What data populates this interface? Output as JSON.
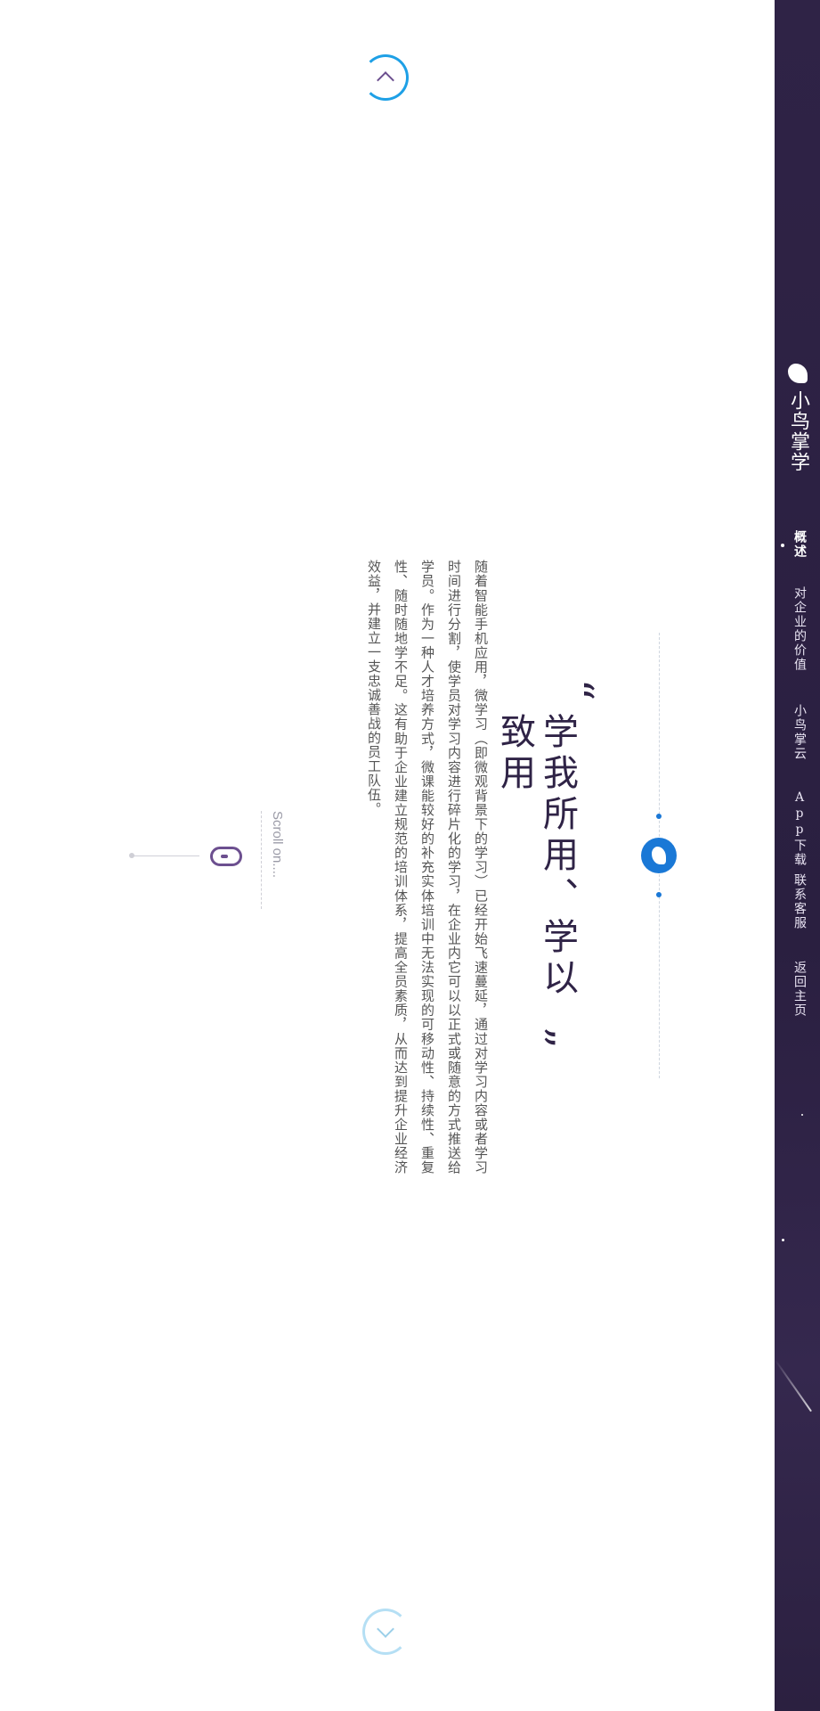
{
  "brand": {
    "name": "小鸟掌学",
    "logo_icon": "bird-logo-icon"
  },
  "nav": {
    "items": [
      {
        "label": "概述",
        "active": true
      },
      {
        "label": "对企业的价值",
        "active": false
      },
      {
        "label": "小鸟掌云",
        "active": false
      },
      {
        "label": "App下载",
        "active": false
      },
      {
        "label": "联系客服",
        "active": false
      },
      {
        "label": "返回主页",
        "active": false
      }
    ]
  },
  "hero": {
    "headline": "学我所用、学以致用",
    "quote_open": "“",
    "quote_close": "”",
    "body": "随着智能手机应用，微学习（即微观背景下的学习）已经开始飞速蔓延，通过对学习内容或者学习时间进行分割，使学员对学习内容进行碎片化的学习，在企业内它可以以正式或随意的方式推送给学员。作为一种人才培养方式，微课能较好的补充实体培训中无法实现的可移动性、持续性、重复性、随时随地学不足。这有助于企业建立规范的培训体系，提高全员素质，从而达到提升企业经济效益，并建立一支忠诚善战的员工队伍。"
  },
  "scroll_hint": {
    "text": "Scroll on....",
    "icon": "mouse-icon"
  },
  "controls": {
    "up_icon": "chevron-up-icon",
    "down_icon": "chevron-down-icon"
  },
  "colors": {
    "sidebar_bg": "#2f2346",
    "accent_blue": "#1a78d6",
    "ring_blue": "#1ea0e6",
    "headline": "#2f2346",
    "body_text": "#555555"
  }
}
